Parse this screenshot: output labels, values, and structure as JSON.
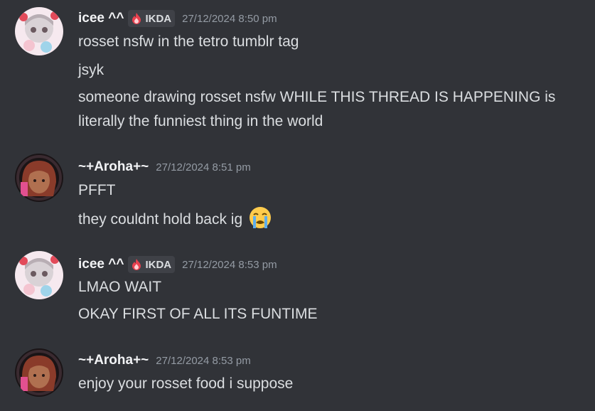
{
  "messages": [
    {
      "username": "icee ^^",
      "tag": {
        "label": "IKDA",
        "icon": "flame-icon"
      },
      "timestamp": "27/12/2024 8:50 pm",
      "lines": [
        "rosset nsfw in the tetro tumblr tag",
        "jsyk",
        "someone drawing rosset nsfw WHILE THIS THREAD IS HAPPENING is literally the funniest thing in the world"
      ]
    },
    {
      "username": "~+Aroha+~",
      "timestamp": "27/12/2024 8:51 pm",
      "lines": [
        "PFFT",
        "they couldnt hold back ig"
      ],
      "emoji": "loudly-crying-emoji"
    },
    {
      "username": "icee ^^",
      "tag": {
        "label": "IKDA",
        "icon": "flame-icon"
      },
      "timestamp": "27/12/2024 8:53 pm",
      "lines": [
        "LMAO WAIT",
        "OKAY FIRST OF ALL ITS FUNTIME"
      ]
    },
    {
      "username": "~+Aroha+~",
      "timestamp": "27/12/2024 8:53 pm",
      "lines": [
        "enjoy your rosset food i suppose"
      ]
    }
  ],
  "colors": {
    "background": "#313338",
    "username": "#f2f3f5",
    "text": "#dbdee1",
    "timestamp": "#949ba4",
    "tag_bg": "#3f4147"
  }
}
